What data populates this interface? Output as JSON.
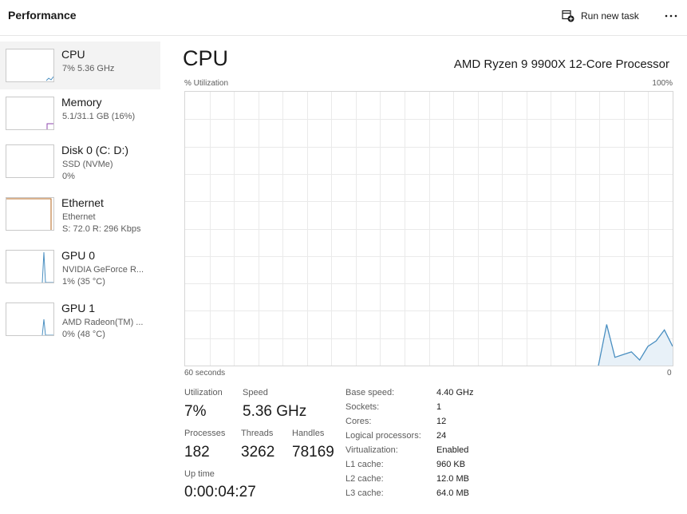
{
  "header": {
    "title": "Performance",
    "run_task_label": "Run new task",
    "more_label": "..."
  },
  "sidebar": {
    "items": [
      {
        "name": "CPU",
        "sub1": "7% 5.36 GHz",
        "sub2": ""
      },
      {
        "name": "Memory",
        "sub1": "5.1/31.1 GB (16%)",
        "sub2": ""
      },
      {
        "name": "Disk 0 (C: D:)",
        "sub1": "SSD (NVMe)",
        "sub2": "0%"
      },
      {
        "name": "Ethernet",
        "sub1": "Ethernet",
        "sub2": "S: 72.0 R: 296 Kbps"
      },
      {
        "name": "GPU 0",
        "sub1": "NVIDIA GeForce R...",
        "sub2": "1% (35 °C)"
      },
      {
        "name": "GPU 1",
        "sub1": "AMD Radeon(TM) ...",
        "sub2": "0% (48 °C)"
      }
    ]
  },
  "main": {
    "title": "CPU",
    "model": "AMD Ryzen 9 9900X 12-Core Processor",
    "graph": {
      "y_label": "% Utilization",
      "y_max_label": "100%",
      "x_left_label": "60 seconds",
      "x_right_label": "0",
      "line_color": "#4a8fc1",
      "fill_color": "#e8f1f8",
      "grid_color": "#eaeaea",
      "recent_values": [
        0,
        15,
        3,
        4,
        5,
        2,
        7,
        9,
        13,
        7
      ]
    },
    "stats": {
      "utilization_label": "Utilization",
      "utilization_value": "7%",
      "speed_label": "Speed",
      "speed_value": "5.36 GHz",
      "processes_label": "Processes",
      "processes_value": "182",
      "threads_label": "Threads",
      "threads_value": "3262",
      "handles_label": "Handles",
      "handles_value": "78169",
      "uptime_label": "Up time",
      "uptime_value": "0:00:04:27"
    },
    "specs": [
      {
        "label": "Base speed:",
        "value": "4.40 GHz"
      },
      {
        "label": "Sockets:",
        "value": "1"
      },
      {
        "label": "Cores:",
        "value": "12"
      },
      {
        "label": "Logical processors:",
        "value": "24"
      },
      {
        "label": "Virtualization:",
        "value": "Enabled"
      },
      {
        "label": "L1 cache:",
        "value": "960 KB"
      },
      {
        "label": "L2 cache:",
        "value": "12.0 MB"
      },
      {
        "label": "L3 cache:",
        "value": "64.0 MB"
      }
    ]
  }
}
